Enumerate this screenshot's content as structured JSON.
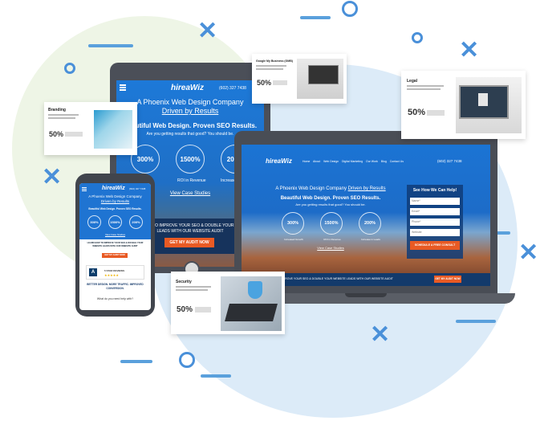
{
  "site": {
    "logo": "hireaWiz",
    "phone": "(602) 327 7438",
    "nav": [
      "Home",
      "About",
      "Web Design",
      "Digital Marketing",
      "Our Work",
      "Blog",
      "Contact Us"
    ],
    "tagline_line1": "A Phoenix Web Design Company",
    "tagline_highlight": "Driven by Results",
    "headline": "Beautiful Web Design. Proven SEO Results.",
    "subheadline": "Are you getting results that good? You should be.",
    "stats": [
      {
        "value": "300%",
        "caption": "Increased Growth"
      },
      {
        "value": "1500%",
        "caption": "ROI in Revenue"
      },
      {
        "value": "200%",
        "caption": "Increase in Leads"
      }
    ],
    "view_case_studies": "View Case Studies",
    "banner_text": "LEARN HOW TO IMPROVE YOUR SEO & DOUBLE YOUR WEBSITE LEADS WITH OUR WEBSITE AUDIT",
    "banner_cta": "GET MY AUDIT NOW",
    "form": {
      "title": "See How We Can Help!",
      "fields": [
        "Name*",
        "Email*",
        "Phone*",
        "Website"
      ],
      "submit": "SCHEDULE A FREE CONSULT"
    },
    "reviews_label": "5 STAR REVIEWS",
    "phone_blurb": "BETTER DESIGN. MORE TRAFFIC. IMPROVED CONVERSION.",
    "phone_question": "What do you need help with?"
  },
  "cards": {
    "branding": {
      "title": "Branding",
      "pct": "50%"
    },
    "gmb": {
      "title": "Google My Business (GMB)",
      "pct": "50%"
    },
    "legal": {
      "title": "Legal",
      "pct": "50%"
    },
    "security": {
      "title": "Security",
      "pct": "50%"
    }
  }
}
